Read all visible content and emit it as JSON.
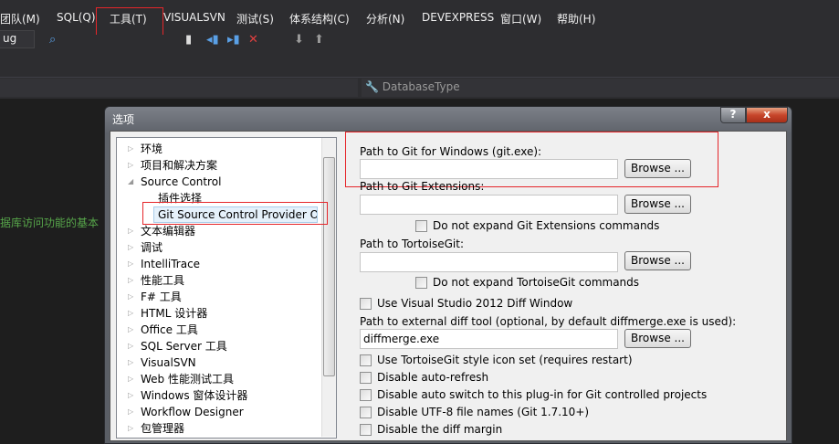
{
  "menu": [
    "团队(M)",
    "SQL(Q)",
    "工具(T)",
    "VISUALSVN",
    "测试(S)",
    "体系结构(C)",
    "分析(N)",
    "DEVEXPRESS",
    "窗口(W)",
    "帮助(H)"
  ],
  "toolbar": {
    "config": "ug"
  },
  "navbar": {
    "member": "DatabaseType"
  },
  "editor": {
    "comment": "据库访问功能的基本"
  },
  "dialog": {
    "title": "选项",
    "help": "?",
    "close": "x"
  },
  "tree": [
    "环境",
    "项目和解决方案",
    "Source Control",
    "插件选择",
    "Git Source Control Provider Optio",
    "文本编辑器",
    "调试",
    "IntelliTrace",
    "性能工具",
    "F# 工具",
    "HTML 设计器",
    "Office 工具",
    "SQL Server 工具",
    "VisualSVN",
    "Web 性能测试工具",
    "Windows 窗体设计器",
    "Workflow Designer",
    "包管理器"
  ],
  "options": {
    "git_label": "Path to Git for Windows (git.exe):",
    "git_value": "",
    "gitext_label": "Path to Git Extensions:",
    "gitext_value": "",
    "gitext_noexpand": "Do not expand Git Extensions commands",
    "tgit_label": "Path to TortoiseGit:",
    "tgit_value": "",
    "tgit_noexpand": "Do not expand TortoiseGit commands",
    "vs2012diff": "Use Visual Studio 2012 Diff Window",
    "diff_label": "Path to external diff tool (optional, by default diffmerge.exe is used):",
    "diff_value": "diffmerge.exe",
    "browse": "Browse ...",
    "checks": [
      "Use TortoiseGit style icon set (requires restart)",
      "Disable auto-refresh",
      "Disable auto switch to this plug-in for Git controlled projects",
      "Disable UTF-8 file names (Git 1.7.10+)",
      "Disable the diff margin"
    ]
  }
}
